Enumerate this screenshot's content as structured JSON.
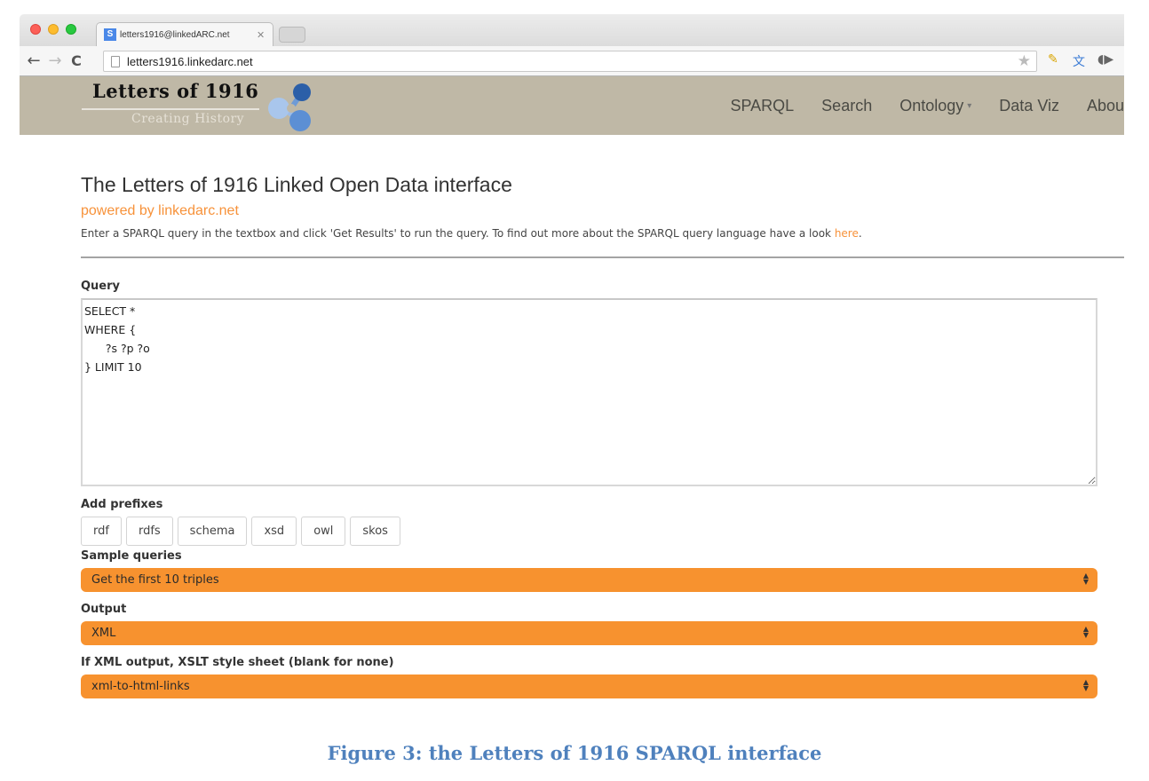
{
  "browser": {
    "tab_title": "letters1916@linkedARC.net",
    "tab_favicon": "S",
    "url": "letters1916.linkedarc.net",
    "icons": [
      "back-arrow-icon",
      "forward-arrow-icon",
      "reload-icon",
      "page-icon",
      "bookmark-star-icon",
      "css-pencil-extension-icon",
      "translate-extension-icon",
      "audio-extension-icon"
    ]
  },
  "site": {
    "logo_title": "Letters of 1916",
    "logo_tagline": "Creating History",
    "nav": [
      {
        "label": "SPARQL"
      },
      {
        "label": "Search"
      },
      {
        "label": "Ontology",
        "has_dropdown": true
      },
      {
        "label": "Data Viz"
      },
      {
        "label": "About"
      }
    ]
  },
  "main": {
    "title": "The Letters of 1916 Linked Open Data interface",
    "powered_by": "powered by linkedarc.net",
    "intro_text": "Enter a SPARQL query in the textbox and click 'Get Results' to run the query. To find out more about the SPARQL query language have a look ",
    "intro_link": "here",
    "intro_end": ".",
    "query_label": "Query",
    "query_value": "SELECT *\nWHERE {\n      ?s ?p ?o\n} LIMIT 10",
    "prefix_label": "Add prefixes",
    "prefixes": [
      "rdf",
      "rdfs",
      "schema",
      "xsd",
      "owl",
      "skos"
    ],
    "sample_label": "Sample queries",
    "sample_selected": "Get the first 10 triples",
    "output_label": "Output",
    "output_selected": "XML",
    "xslt_label": "If XML output, XSLT style sheet (blank for none)",
    "xslt_selected": "xml-to-html-links"
  },
  "colors": {
    "accent": "#f7922f",
    "header_bg": "#bfb8a6",
    "caption": "#4f81bd"
  },
  "caption": "Figure 3: the Letters of 1916 SPARQL interface"
}
